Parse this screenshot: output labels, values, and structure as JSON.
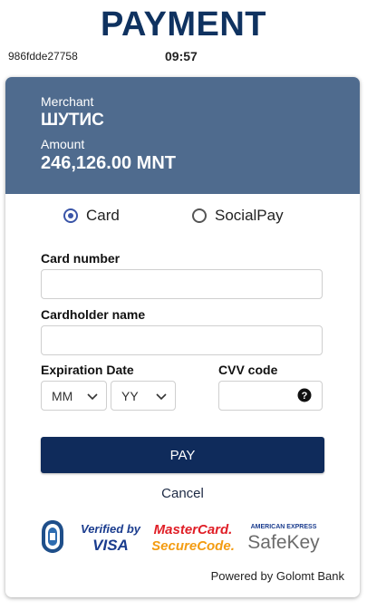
{
  "page": {
    "title": "PAYMENT",
    "session_id": "986fdde27758",
    "timer": "09:57"
  },
  "merchant": {
    "merchant_label": "Merchant",
    "merchant_name": "ШУТИС",
    "amount_label": "Amount",
    "amount_value": "246,126.00 MNT"
  },
  "payment_method": {
    "options": [
      {
        "label": "Card",
        "selected": true
      },
      {
        "label": "SocialPay",
        "selected": false
      }
    ]
  },
  "form": {
    "card_number_label": "Card number",
    "card_number_value": "",
    "cardholder_label": "Cardholder name",
    "cardholder_value": "",
    "expiration_label": "Expiration Date",
    "month_value": "MM",
    "year_value": "YY",
    "cvv_label": "CVV code",
    "cvv_value": ""
  },
  "actions": {
    "pay_label": "PAY",
    "cancel_label": "Cancel"
  },
  "security_logos": {
    "verified_by": "Verified by",
    "visa": "VISA",
    "mastercard": "MasterCard.",
    "securecode": "SecureCode.",
    "amex_top": "AMERICAN EXPRESS",
    "safekey": "SafeKey"
  },
  "footer": {
    "powered_by": "Powered by Golomt Bank"
  },
  "colors": {
    "title": "#0f3260",
    "header_bg": "#4f6b8e",
    "pay_button": "#0f2b5b",
    "radio_selected": "#3a55a8"
  }
}
